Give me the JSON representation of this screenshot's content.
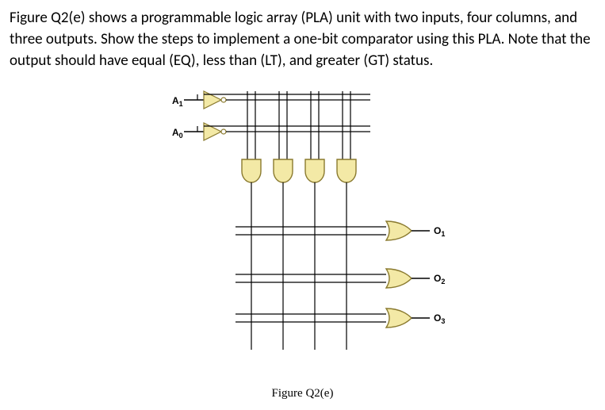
{
  "question": {
    "text": "Figure Q2(e) shows a programmable logic array (PLA) unit with two inputs, four columns, and three outputs. Show the steps to implement a one-bit comparator using this PLA. Note that the output should have equal (EQ), less than (LT), and greater (GT) status."
  },
  "figure": {
    "caption": "Figure Q2(e)",
    "inputs": {
      "a1": "A",
      "a1_sub": "1",
      "a0": "A",
      "a0_sub": "0"
    },
    "outputs": {
      "o1": "O",
      "o1_sub": "1",
      "o2": "O",
      "o2_sub": "2",
      "o3": "O",
      "o3_sub": "3"
    }
  }
}
